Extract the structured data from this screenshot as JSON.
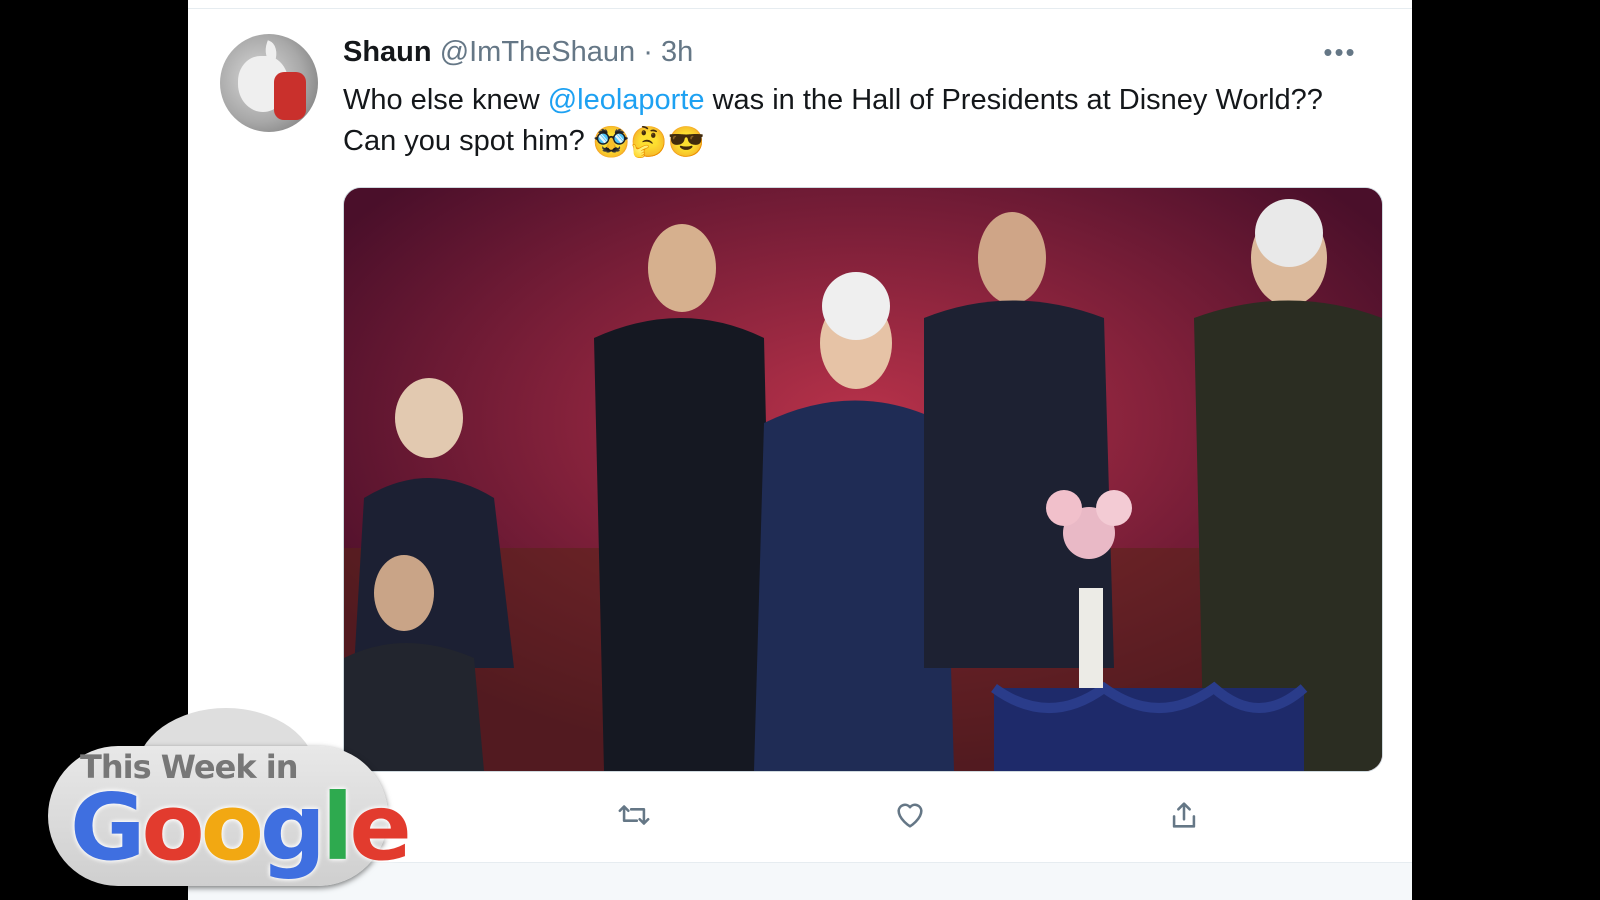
{
  "tweet": {
    "display_name": "Shaun",
    "handle": "@ImTheShaun",
    "separator": "·",
    "time": "3h",
    "more_icon": "ellipsis-icon",
    "text_before": "Who else knew ",
    "mention": "@leolaporte",
    "text_after": " was in the Hall of Presidents at Disney World??",
    "text_line2": "Can you spot him? ",
    "emojis": [
      "🥸",
      "🤔",
      "😎"
    ]
  },
  "actions": {
    "reply_icon": "reply-icon",
    "retweet_icon": "retweet-icon",
    "like_icon": "heart-icon",
    "share_icon": "share-icon"
  },
  "overlay_logo": {
    "line1": "This Week in",
    "google_letters": [
      "G",
      "o",
      "o",
      "g",
      "l",
      "e"
    ],
    "google_colors": [
      "#3f6fe0",
      "#e23b2e",
      "#f2a812",
      "#3f6fe0",
      "#2eaa4f",
      "#e23b2e"
    ]
  },
  "colors": {
    "mention": "#1da1f2",
    "secondary_text": "#657786"
  }
}
